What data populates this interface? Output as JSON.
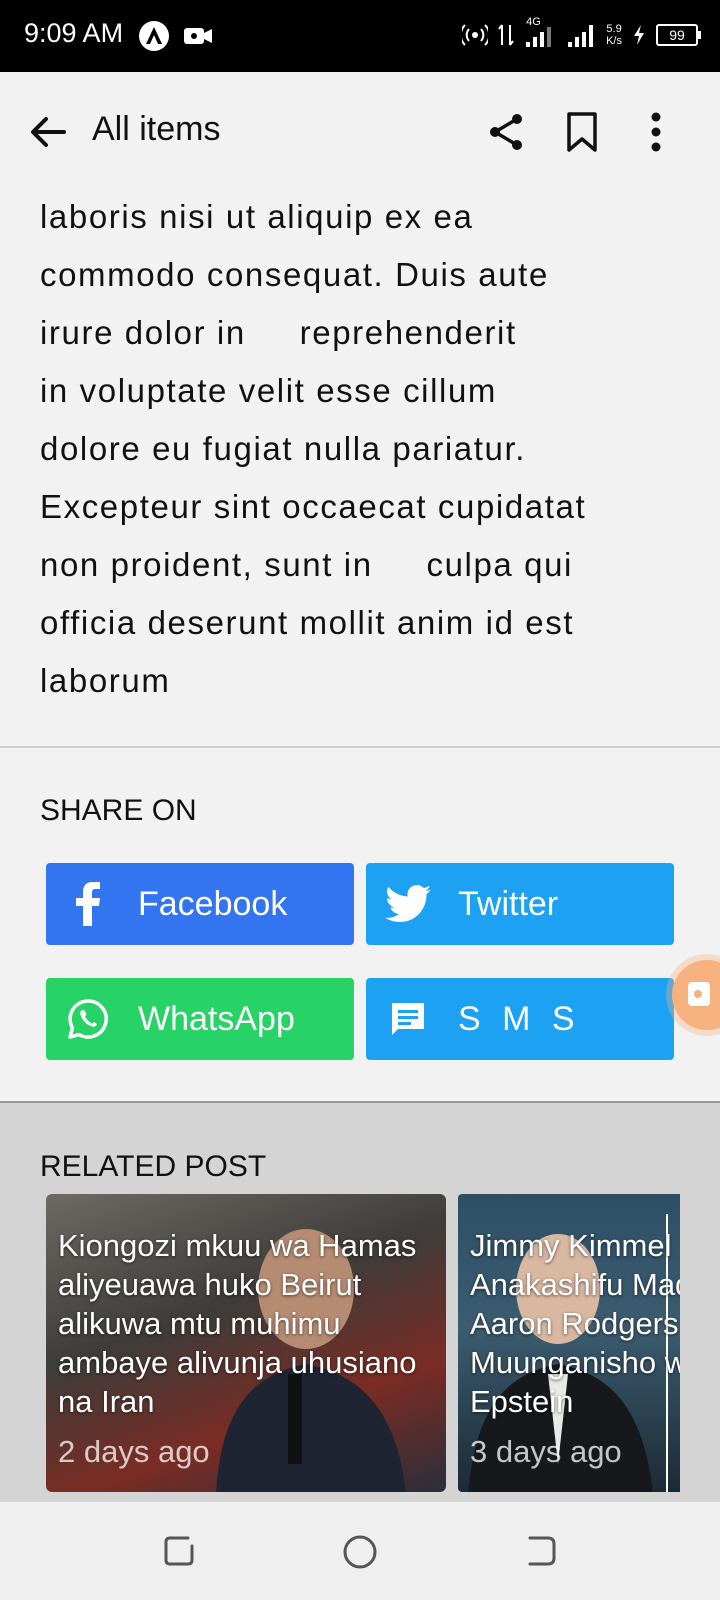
{
  "status_bar": {
    "time": "9:09 AM",
    "network": "4G",
    "speed": "5.9\nK/s",
    "battery": "99"
  },
  "app_bar": {
    "title": "All items",
    "icons": [
      "back-arrow-icon",
      "share-icon",
      "bookmark-icon",
      "more-vert-icon"
    ]
  },
  "article": {
    "text": "laboris nisi ut aliquip ex ea\ncommodo consequat. Duis aute\nirure dolor in     reprehenderit\nin voluptate velit esse cillum\ndolore eu fugiat nulla pariatur.\nExcepteur sint occaecat cupidatat\nnon proident, sunt in     culpa qui\nofficia deserunt mollit anim id est\nlaborum"
  },
  "share": {
    "title": "SHARE ON",
    "buttons": [
      {
        "label": "Facebook",
        "icon": "facebook-icon",
        "color": "#3375f0"
      },
      {
        "label": "Twitter",
        "icon": "twitter-icon",
        "color": "#1da1f2"
      },
      {
        "label": "WhatsApp",
        "icon": "whatsapp-icon",
        "color": "#27d366"
      },
      {
        "label": "S M S",
        "icon": "sms-icon",
        "color": "#1da1f2"
      }
    ]
  },
  "related": {
    "title": "RELATED POST",
    "posts": [
      {
        "headline": "Kiongozi mkuu wa Hamas aliyeuawa huko Beirut alikuwa mtu muhimu ambaye alivunja uhusiano na Iran",
        "time": "2 days ago"
      },
      {
        "headline": "Jimmy Kimmel Anakashifu Madai ya Aaron Rodgers ya Muunganisho wa Epstein",
        "time": "3 days ago"
      }
    ]
  },
  "nav_bar": {
    "icons": [
      "recent-apps-icon",
      "home-icon",
      "back-nav-icon"
    ]
  }
}
